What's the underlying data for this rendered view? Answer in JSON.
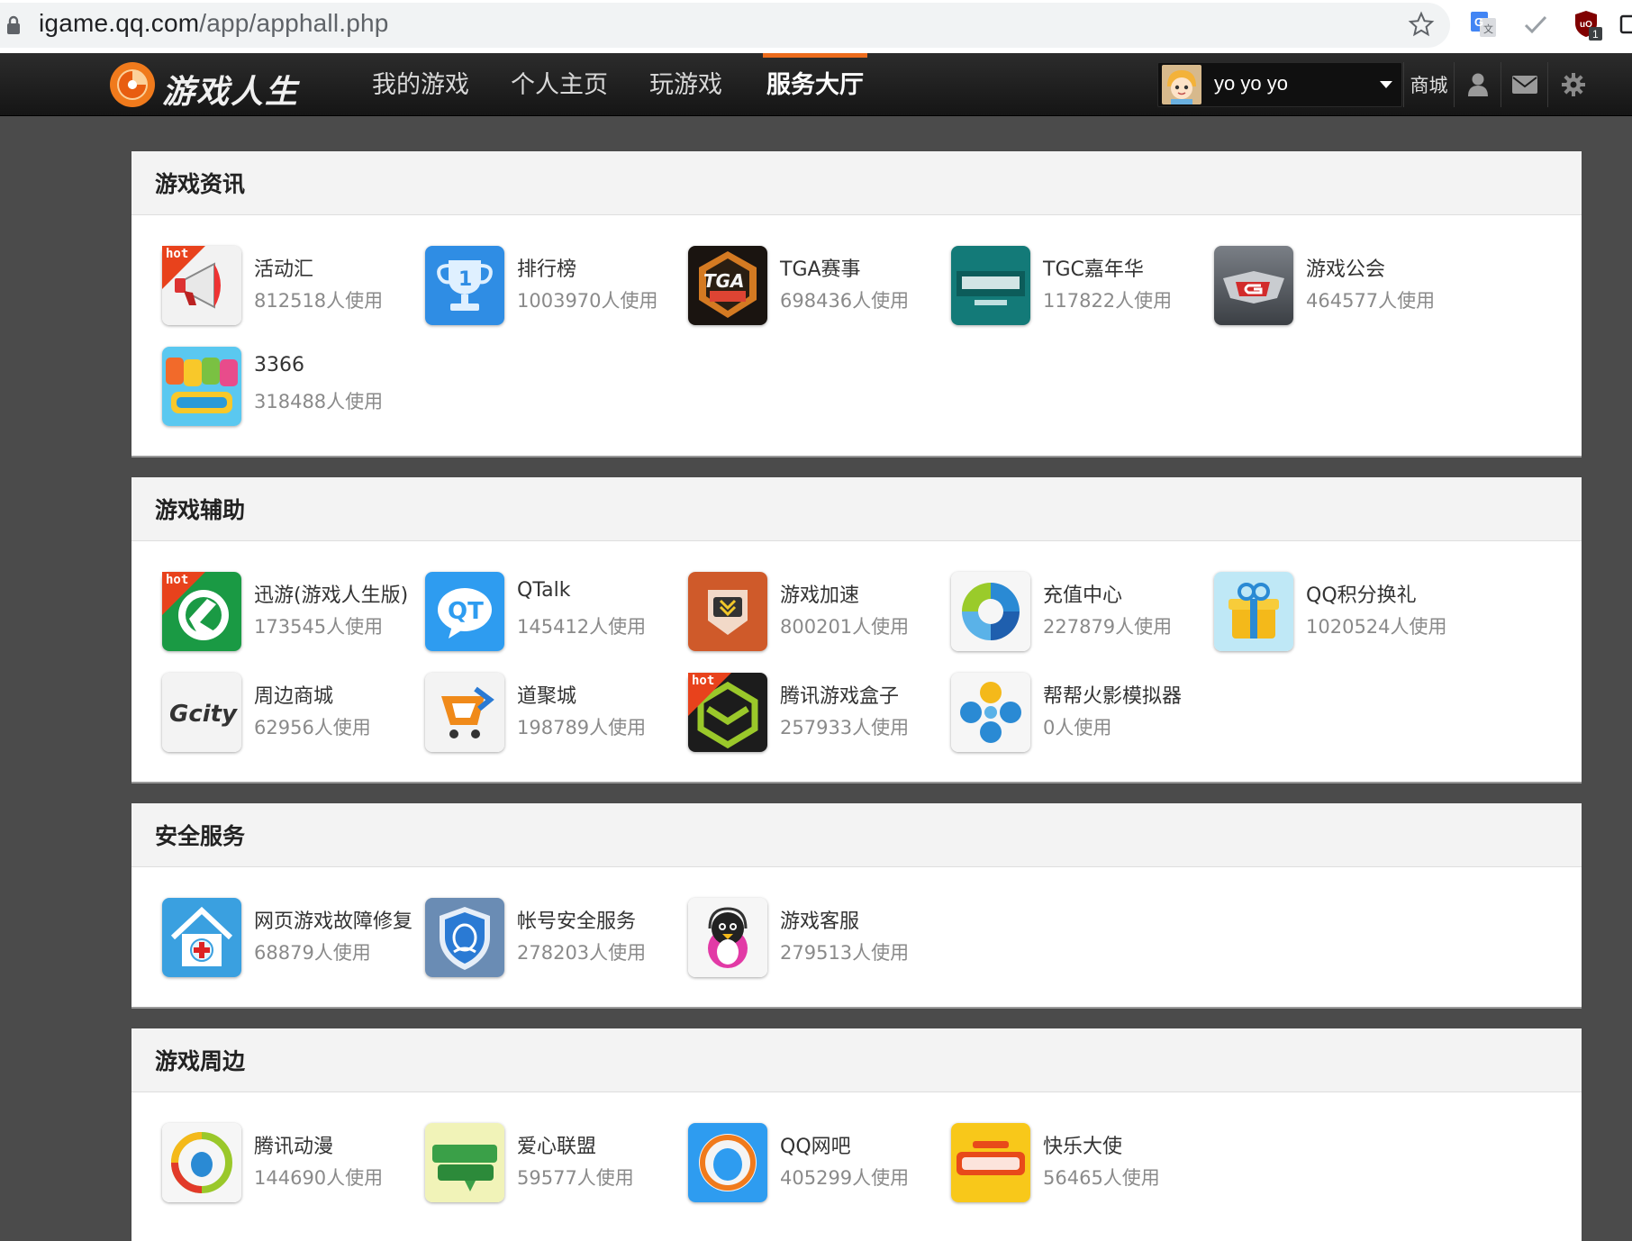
{
  "browser": {
    "url_host": "igame.qq.com",
    "url_path": "/app/apphall.php",
    "ext_badge": "1"
  },
  "site": {
    "logo_text": "游戏人生",
    "tabs": [
      {
        "label": "我的游戏",
        "active": false
      },
      {
        "label": "个人主页",
        "active": false
      },
      {
        "label": "玩游戏",
        "active": false
      },
      {
        "label": "服务大厅",
        "active": true
      }
    ],
    "user_name": "yo yo yo",
    "shop_label": "商城"
  },
  "colors": {
    "accent": "#ec6c1d",
    "nav_bg": "#1c1c1c",
    "page_bg": "#4b4b4b"
  },
  "sections": [
    {
      "title": "游戏资讯",
      "apps": [
        {
          "name": "活动汇",
          "users": "812518人使用",
          "icon": "megaphone-icon",
          "hot": true
        },
        {
          "name": "排行榜",
          "users": "1003970人使用",
          "icon": "trophy-icon",
          "hot": false
        },
        {
          "name": "TGA赛事",
          "users": "698436人使用",
          "icon": "tga-icon",
          "hot": false
        },
        {
          "name": "TGC嘉年华",
          "users": "117822人使用",
          "icon": "tgc-icon",
          "hot": false
        },
        {
          "name": "游戏公会",
          "users": "464577人使用",
          "icon": "guild-icon",
          "hot": false
        },
        {
          "name": "3366",
          "users": "318488人使用",
          "icon": "3366-icon",
          "hot": false
        }
      ]
    },
    {
      "title": "游戏辅助",
      "apps": [
        {
          "name": "迅游(游戏人生版)",
          "users": "173545人使用",
          "icon": "xunyou-icon",
          "hot": true
        },
        {
          "name": "QTalk",
          "users": "145412人使用",
          "icon": "qtalk-icon",
          "hot": false
        },
        {
          "name": "游戏加速",
          "users": "800201人使用",
          "icon": "accelerator-icon",
          "hot": false
        },
        {
          "name": "充值中心",
          "users": "227879人使用",
          "icon": "recharge-icon",
          "hot": false
        },
        {
          "name": "QQ积分换礼",
          "users": "1020524人使用",
          "icon": "gift-icon",
          "hot": false
        },
        {
          "name": "周边商城",
          "users": "62956人使用",
          "icon": "gcity-icon",
          "hot": false
        },
        {
          "name": "道聚城",
          "users": "198789人使用",
          "icon": "cart-icon",
          "hot": false
        },
        {
          "name": "腾讯游戏盒子",
          "users": "257933人使用",
          "icon": "gamebox-icon",
          "hot": true
        },
        {
          "name": "帮帮火影模拟器",
          "users": "0人使用",
          "icon": "emulator-icon",
          "hot": false
        }
      ]
    },
    {
      "title": "安全服务",
      "apps": [
        {
          "name": "网页游戏故障修复",
          "users": "68879人使用",
          "icon": "repair-icon",
          "hot": false
        },
        {
          "name": "帐号安全服务",
          "users": "278203人使用",
          "icon": "account-shield-icon",
          "hot": false
        },
        {
          "name": "游戏客服",
          "users": "279513人使用",
          "icon": "service-penguin-icon",
          "hot": false
        }
      ]
    },
    {
      "title": "游戏周边",
      "apps": [
        {
          "name": "腾讯动漫",
          "users": "144690人使用",
          "icon": "comic-icon",
          "hot": false
        },
        {
          "name": "爱心联盟",
          "users": "59577人使用",
          "icon": "charity-icon",
          "hot": false
        },
        {
          "name": "QQ网吧",
          "users": "405299人使用",
          "icon": "netbar-icon",
          "hot": false
        },
        {
          "name": "快乐大使",
          "users": "56465人使用",
          "icon": "ambassador-icon",
          "hot": false
        }
      ]
    }
  ]
}
